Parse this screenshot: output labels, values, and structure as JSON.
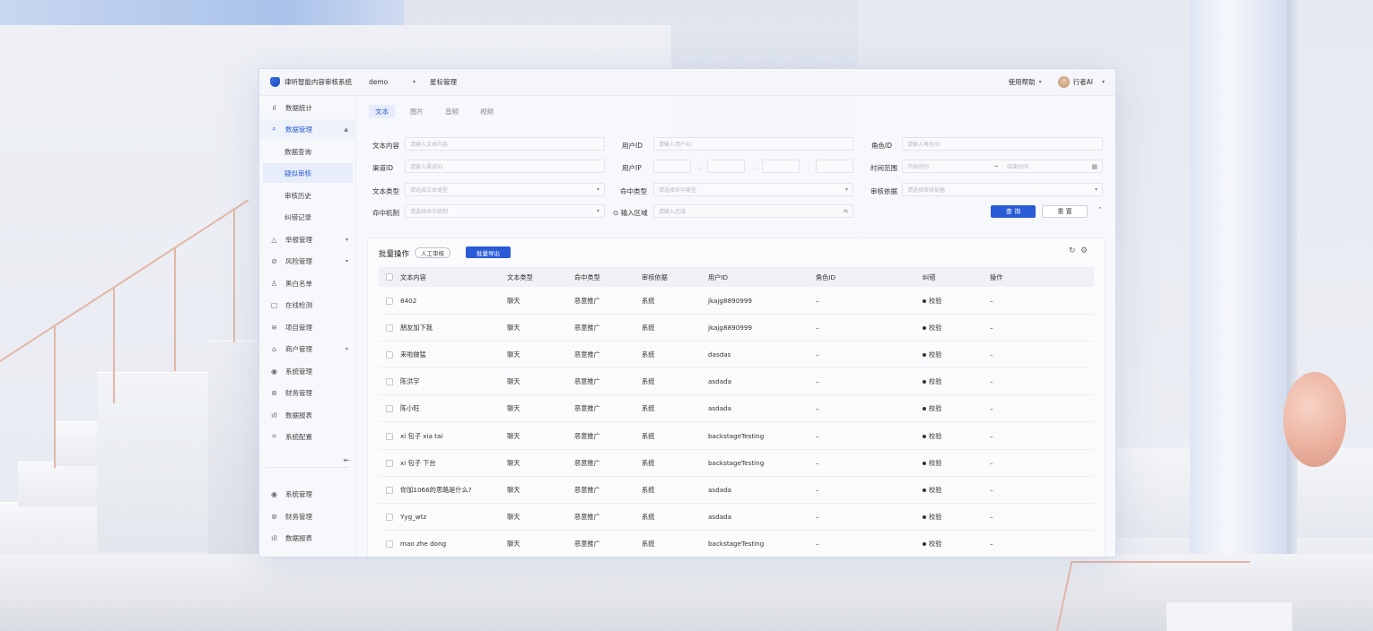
{
  "app": {
    "title": "律听智能内容审核系统",
    "project": "demo",
    "menu": "星标管理",
    "help": "使用帮助",
    "user": "行者AI"
  },
  "sidebar": {
    "items": [
      {
        "label": "数据统计",
        "icon": "bar-chart-icon",
        "glyph": "📊"
      },
      {
        "label": "数据管理",
        "icon": "search-doc-icon",
        "glyph": "⌕"
      },
      {
        "label": "数据查询"
      },
      {
        "label": "疑似审核"
      },
      {
        "label": "审核历史"
      },
      {
        "label": "纠错记录"
      },
      {
        "label": "举报管理",
        "icon": "warning-icon",
        "glyph": "△"
      },
      {
        "label": "风险管理",
        "icon": "risk-icon",
        "glyph": "⊘"
      },
      {
        "label": "黑白名单",
        "icon": "user-icon",
        "glyph": "♙"
      },
      {
        "label": "在线检测",
        "icon": "monitor-icon",
        "glyph": "▢"
      },
      {
        "label": "项目管理",
        "icon": "layers-icon",
        "glyph": "≋"
      },
      {
        "label": "商户管理",
        "icon": "home-icon",
        "glyph": "⌂"
      },
      {
        "label": "系统管理",
        "icon": "settings-icon",
        "glyph": "◉"
      },
      {
        "label": "财务管理",
        "icon": "finance-icon",
        "glyph": "⊛"
      },
      {
        "label": "数据报表",
        "icon": "report-icon",
        "glyph": "▥"
      },
      {
        "label": "系统配置",
        "icon": "config-icon",
        "glyph": "⌗"
      },
      {
        "label": "系统管理",
        "icon": "settings-icon",
        "glyph": "◉"
      },
      {
        "label": "财务管理",
        "icon": "finance-icon",
        "glyph": "⊛"
      },
      {
        "label": "数据报表",
        "icon": "report-icon",
        "glyph": "▥"
      }
    ],
    "collapse_glyph": "⇤"
  },
  "tabs": [
    "文本",
    "图片",
    "音频",
    "视频"
  ],
  "filters": {
    "text_content": {
      "label": "文本内容",
      "placeholder": "请输入文本内容"
    },
    "user_id": {
      "label": "用户ID",
      "placeholder": "请输入用户ID"
    },
    "role_id": {
      "label": "角色ID",
      "placeholder": "请输入角色ID"
    },
    "channel_id": {
      "label": "渠道ID",
      "placeholder": "请输入渠道ID"
    },
    "user_ip": {
      "label": "用户IP"
    },
    "time_range": {
      "label": "时间范围",
      "start": "开始时间",
      "end": "结束时间"
    },
    "text_type": {
      "label": "文本类型",
      "placeholder": "请选择文本类型"
    },
    "hit_type": {
      "label": "命中类型",
      "placeholder": "请选择命中类型"
    },
    "review_basis": {
      "label": "审核依据",
      "placeholder": "请选择审核依据"
    },
    "hit_mechanism": {
      "label": "命中机制",
      "placeholder": "请选择命中机制"
    },
    "input_area": {
      "label": "输入区域",
      "placeholder": "请输入区域"
    },
    "search_label": "查 询",
    "reset_label": "重 置"
  },
  "batch": {
    "title": "批量操作",
    "manual_label": "人工审核",
    "export_label": "批量导出"
  },
  "table": {
    "columns": [
      "文本内容",
      "文本类型",
      "命中类型",
      "审核依据",
      "用户ID",
      "角色ID",
      "纠错",
      "操作"
    ],
    "rows": [
      [
        "8402",
        "聊天",
        "恶意推广",
        "系统",
        "jkajg8890999",
        "–",
        "校验",
        "–"
      ],
      [
        "朋友加下我",
        "聊天",
        "恶意推广",
        "系统",
        "jkajg8890999",
        "–",
        "校验",
        "–"
      ],
      [
        "来啦做猛",
        "聊天",
        "恶意推广",
        "系统",
        "dasdas",
        "–",
        "校验",
        "–"
      ],
      [
        "陈洪宇",
        "聊天",
        "恶意推广",
        "系统",
        "asdada",
        "–",
        "校验",
        "–"
      ],
      [
        "陈小旺",
        "聊天",
        "恶意推广",
        "系统",
        "asdada",
        "–",
        "校验",
        "–"
      ],
      [
        "xi 包子 xia tai",
        "聊天",
        "恶意推广",
        "系统",
        "backstageTesting",
        "–",
        "校验",
        "–"
      ],
      [
        "xi 包子 下台",
        "聊天",
        "恶意推广",
        "系统",
        "backstageTesting",
        "–",
        "校验",
        "–"
      ],
      [
        "你加1066的思路是什么?",
        "聊天",
        "恶意推广",
        "系统",
        "asdada",
        "–",
        "校验",
        "–"
      ],
      [
        "Yyg_wtz",
        "聊天",
        "恶意推广",
        "系统",
        "asdada",
        "–",
        "校验",
        "–"
      ],
      [
        "mao zhe dong",
        "聊天",
        "恶意推广",
        "系统",
        "backstageTesting",
        "–",
        "校验",
        "–"
      ]
    ]
  },
  "colors": {
    "accent": "#2a5bd7",
    "active_bg": "#e7edfb"
  }
}
